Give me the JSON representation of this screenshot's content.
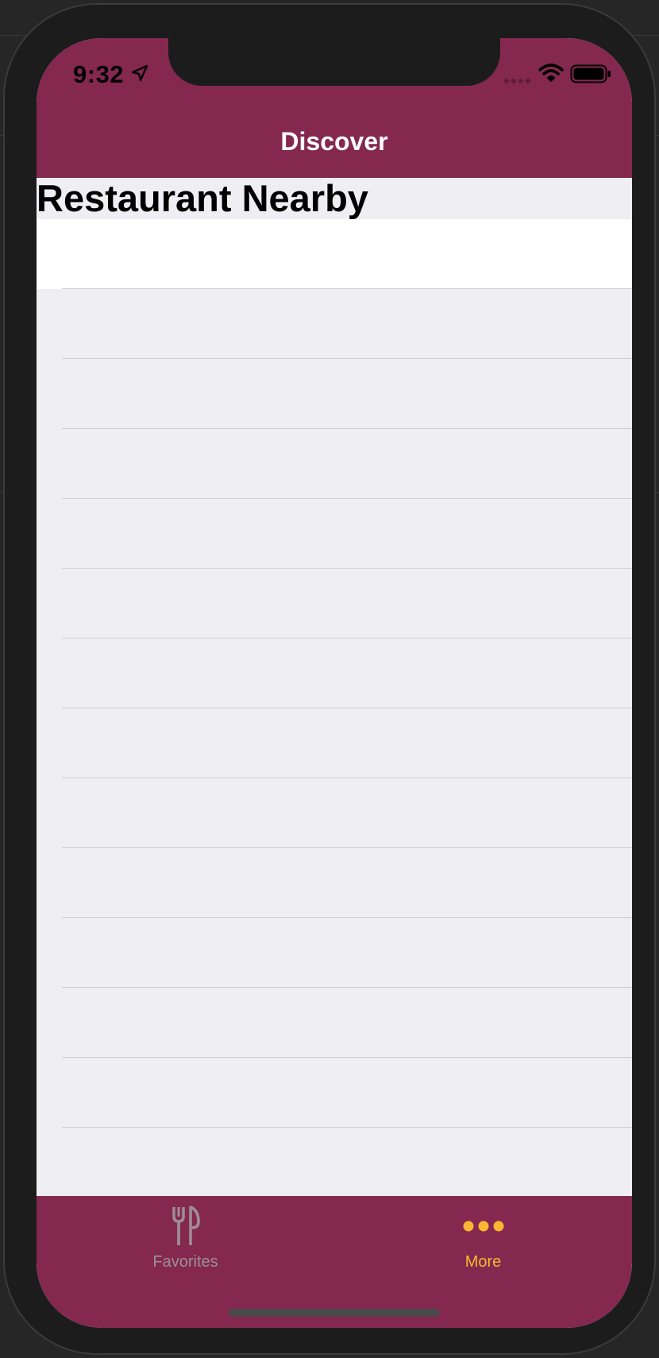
{
  "status_bar": {
    "time": "9:32",
    "icons": [
      "location-arrow-icon",
      "signal-icon",
      "wifi-icon",
      "battery-icon"
    ]
  },
  "nav": {
    "title": "Discover"
  },
  "section": {
    "title": "Restaurant Nearby"
  },
  "list": {
    "row_count": 15
  },
  "tab_bar": {
    "tabs": [
      {
        "label": "Favorites",
        "icon": "fork-knife-icon",
        "selected": false
      },
      {
        "label": "More",
        "icon": "more-dots-icon",
        "selected": true
      }
    ]
  },
  "colors": {
    "brand": "#842850",
    "background": "#efeef3",
    "tab_selected": "#fbb731",
    "tab_unselected": "#9e8d95",
    "separator": "#cfced4"
  }
}
